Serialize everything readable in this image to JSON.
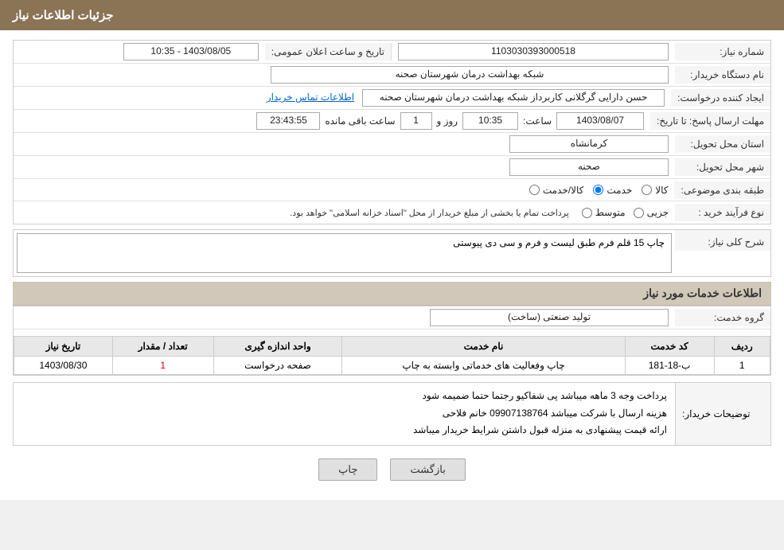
{
  "header": {
    "title": "جزئیات اطلاعات نیاز"
  },
  "fields": {
    "need_number_label": "شماره نیاز:",
    "need_number_value": "1103030393000518",
    "buyer_label": "نام دستگاه خریدار:",
    "buyer_value": "شبکه بهداشت درمان شهرستان صحنه",
    "creator_label": "ایجاد کننده درخواست:",
    "creator_value": "حسن دارایی گرگلانی کاربرداز شبکه بهداشت درمان شهرستان صحنه",
    "creator_link": "اطلاعات تماس خریدار",
    "response_deadline_label": "مهلت ارسال پاسخ: تا تاریخ:",
    "date_value": "1403/08/07",
    "time_label": "ساعت:",
    "time_value": "10:35",
    "days_label": "روز و",
    "days_value": "1",
    "remaining_label": "ساعت باقی مانده",
    "remaining_value": "23:43:55",
    "announce_label": "تاریخ و ساعت اعلان عمومی:",
    "announce_value": "1403/08/05 - 10:35",
    "province_label": "استان محل تحویل:",
    "province_value": "کرمانشاه",
    "city_label": "شهر محل تحویل:",
    "city_value": "صحنه",
    "category_label": "طبقه بندی موضوعی:",
    "category_options": [
      "کالا",
      "خدمت",
      "کالا/خدمت"
    ],
    "category_selected": "خدمت",
    "purchase_type_label": "نوع فرآیند خرید :",
    "purchase_options": [
      "جزیی",
      "متوسط"
    ],
    "purchase_note": "پرداخت تمام یا بخشی از مبلغ خریدار از محل \"اسناد خزانه اسلامی\" خواهد بود.",
    "need_desc_label": "شرح کلی نیاز:",
    "need_desc_value": "چاپ 15 قلم فرم طبق لیست و فرم و سی دی پیوستی",
    "services_title": "اطلاعات خدمات مورد نیاز",
    "service_group_label": "گروه خدمت:",
    "service_group_value": "تولید صنعتی (ساخت)",
    "table": {
      "headers": [
        "ردیف",
        "کد خدمت",
        "نام خدمت",
        "واحد اندازه گیری",
        "تعداد / مقدار",
        "تاریخ نیاز"
      ],
      "rows": [
        {
          "row": "1",
          "code": "ب-18-181",
          "name": "چاپ وفعالیت های خدماتی وابسته به چاپ",
          "unit": "صفحه درخواست",
          "quantity": "1",
          "date": "1403/08/30"
        }
      ]
    },
    "buyer_notes_label": "توضیحات خریدار:",
    "buyer_notes_lines": [
      "پرداخت وجه 3 ماهه میباشد پی شفاکیو رجتما حتما ضمیمه شود",
      "هزینه ارسال با شرکت میباشد  09907138764  خانم فلاحی",
      "ارائه قیمت پیشنهادی به منزله قبول داشتن شرایط خریدار میباشد"
    ]
  },
  "buttons": {
    "back_label": "بازگشت",
    "print_label": "چاپ"
  }
}
